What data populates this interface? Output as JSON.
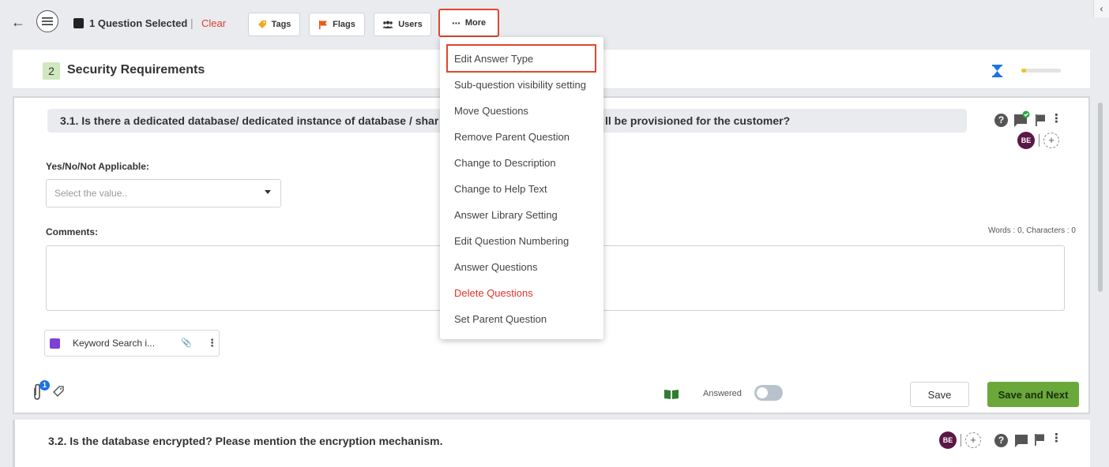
{
  "toolbar": {
    "selected_text": "1 Question Selected",
    "separator": "|",
    "clear_label": "Clear",
    "buttons": {
      "tags": "Tags",
      "flags": "Flags",
      "users": "Users",
      "more": "More"
    },
    "more_icon": "···"
  },
  "section": {
    "number": "2",
    "title": "Security Requirements",
    "progress_fraction": 0.12,
    "colors": {
      "progress": "#f5c21b",
      "hourglass": "#1a73e8"
    }
  },
  "question1": {
    "title": "3.1. Is there a dedicated database/ dedicated instance of database / shar",
    "title_tail": "ll be provisioned for the customer?",
    "avatar": "BE",
    "add_symbol": "+",
    "help_symbol": "?",
    "answer_label": "Yes/No/Not Applicable:",
    "select_placeholder": "Select the value..",
    "comments_label": "Comments:",
    "counter": "Words : 0, Characters : 0",
    "keyword_chip": "Keyword Search i...",
    "attachment_count": "1",
    "answered_label": "Answered",
    "save_label": "Save",
    "save_next_label": "Save and Next"
  },
  "question2": {
    "title": "3.2. Is the database encrypted? Please mention the encryption mechanism.",
    "avatar": "BE",
    "add_symbol": "+",
    "help_symbol": "?"
  },
  "more_menu": {
    "items": [
      "Edit Answer Type",
      "Sub-question visibility setting",
      "Move Questions",
      "Remove Parent Question",
      "Change to Description",
      "Change to Help Text",
      "Answer Library Setting",
      "Edit Question Numbering",
      "Answer Questions",
      "Delete Questions",
      "Set Parent Question"
    ],
    "highlighted_item": "Edit Answer Type",
    "danger_item": "Delete Questions"
  },
  "icons": [
    "back-arrow-icon",
    "hamburger-icon",
    "tag-icon",
    "flag-icon",
    "users-icon",
    "more-dots-icon",
    "hourglass-icon",
    "help-icon",
    "comment-icon",
    "flag-icon",
    "kebab-icon",
    "attachment-icon",
    "tag-outline-icon",
    "book-icon",
    "collapse-chevron-icon"
  ]
}
